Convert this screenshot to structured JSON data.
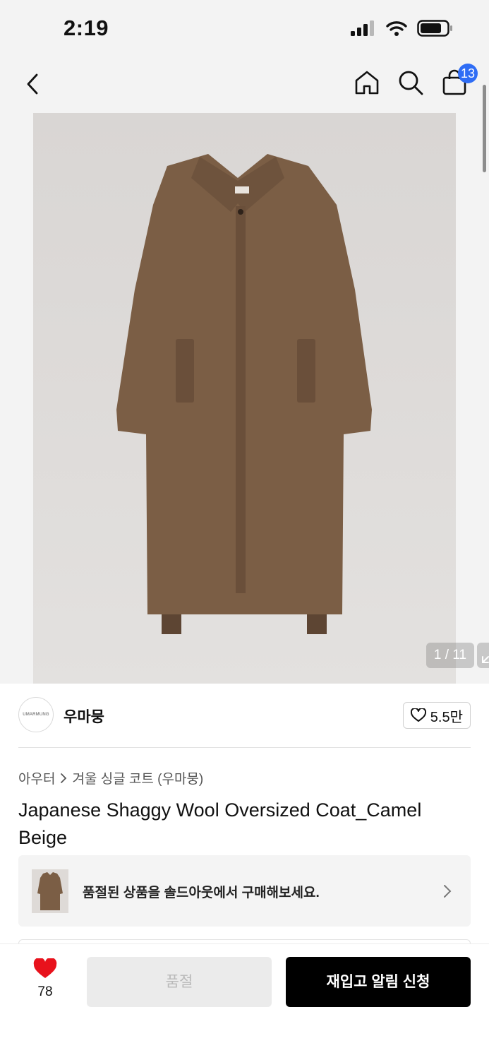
{
  "status": {
    "time": "2:19"
  },
  "nav": {
    "cart_count": "13"
  },
  "gallery": {
    "page_indicator": "1 / 11"
  },
  "brand": {
    "logo_text": "UMARMUNG",
    "name": "우마뭉",
    "like_count": "5.5만"
  },
  "breadcrumb": {
    "category": "아우터",
    "subcategory": "겨울 싱글 코트 (우마뭉)"
  },
  "product": {
    "title": "Japanese Shaggy Wool Oversized Coat_Camel Beige"
  },
  "banner": {
    "text": "품절된 상품을 솔드아웃에서 구매해보세요."
  },
  "bottom": {
    "wish_count": "78",
    "soldout_label": "품절",
    "restock_label": "재입고 알림 신청"
  },
  "colors": {
    "accent_badge": "#2f6df5",
    "heart": "#e8121c",
    "coat": "#7b5e45"
  },
  "icons": [
    "back-icon",
    "home-icon",
    "search-icon",
    "cart-icon",
    "expand-icon",
    "heart-outline-icon",
    "chevron-right-icon",
    "heart-filled-icon"
  ]
}
